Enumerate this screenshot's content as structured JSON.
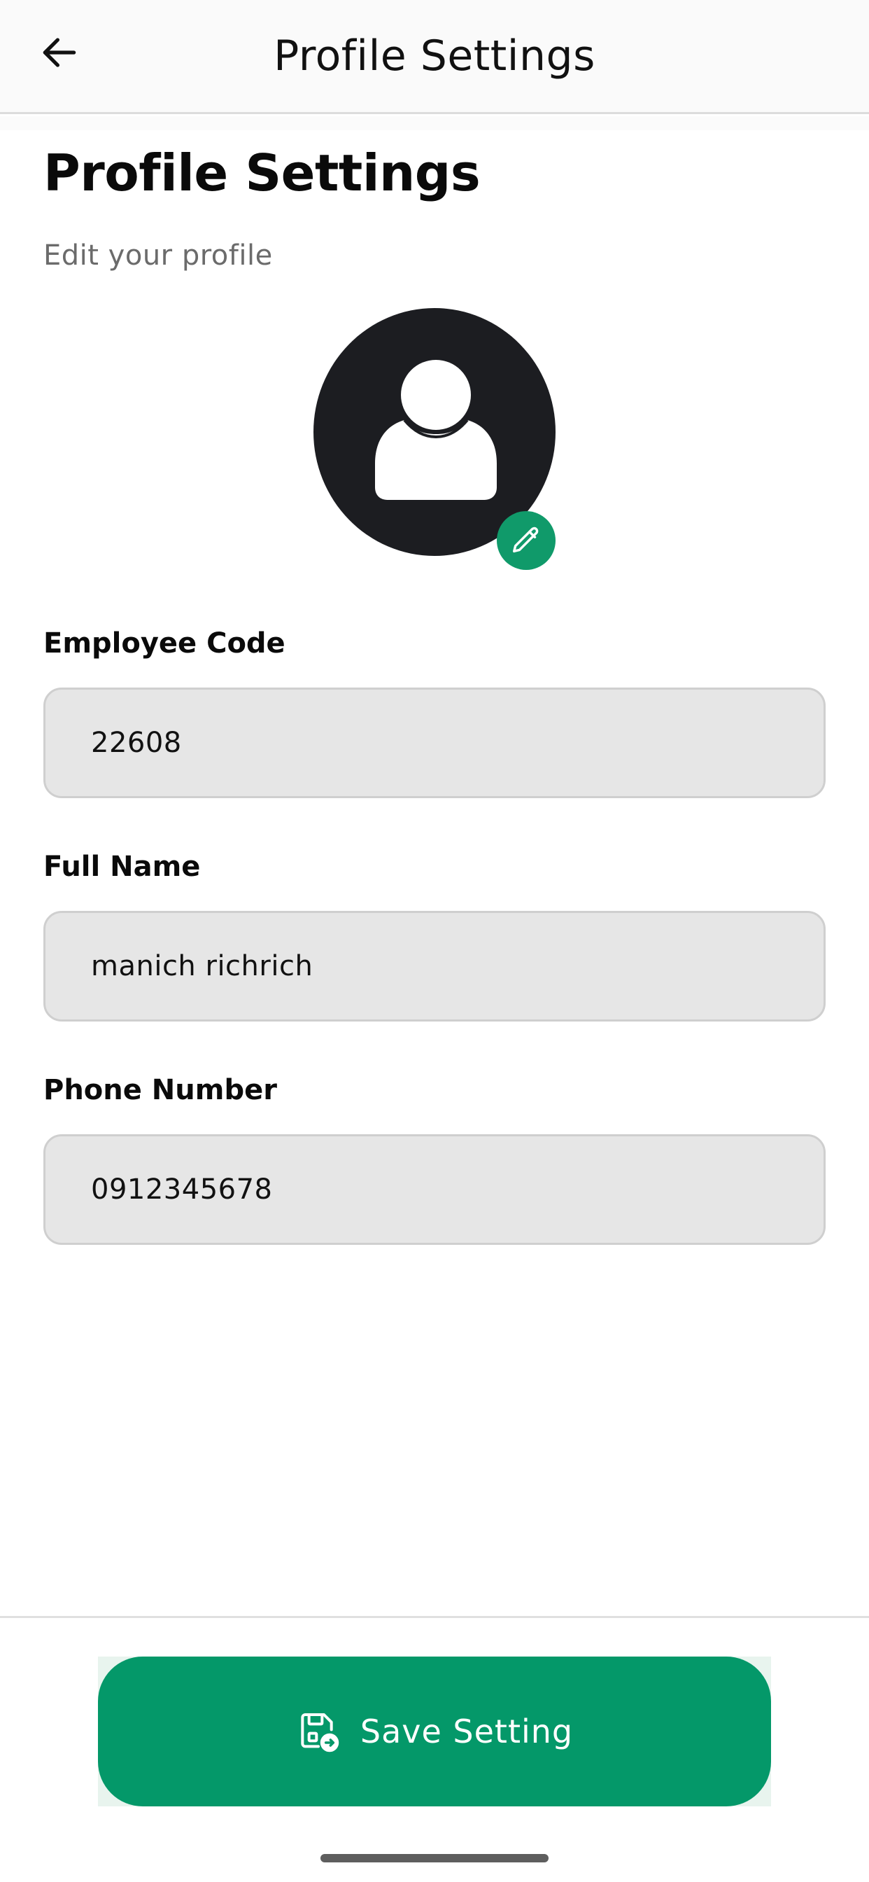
{
  "header": {
    "title": "Profile Settings",
    "back_icon": "arrow-left-icon"
  },
  "page": {
    "title": "Profile Settings",
    "subtitle": "Edit your profile"
  },
  "avatar": {
    "icon": "user-avatar-icon",
    "edit_icon": "pencil-icon",
    "edit_bg_color": "#109a6a"
  },
  "fields": [
    {
      "label": "Employee Code",
      "value": "22608"
    },
    {
      "label": "Full Name",
      "value": "manich richrich"
    },
    {
      "label": "Phone Number",
      "value": "0912345678"
    }
  ],
  "footer": {
    "save_label": "Save Setting",
    "save_icon": "save-file-icon",
    "accent_color": "#049869"
  }
}
